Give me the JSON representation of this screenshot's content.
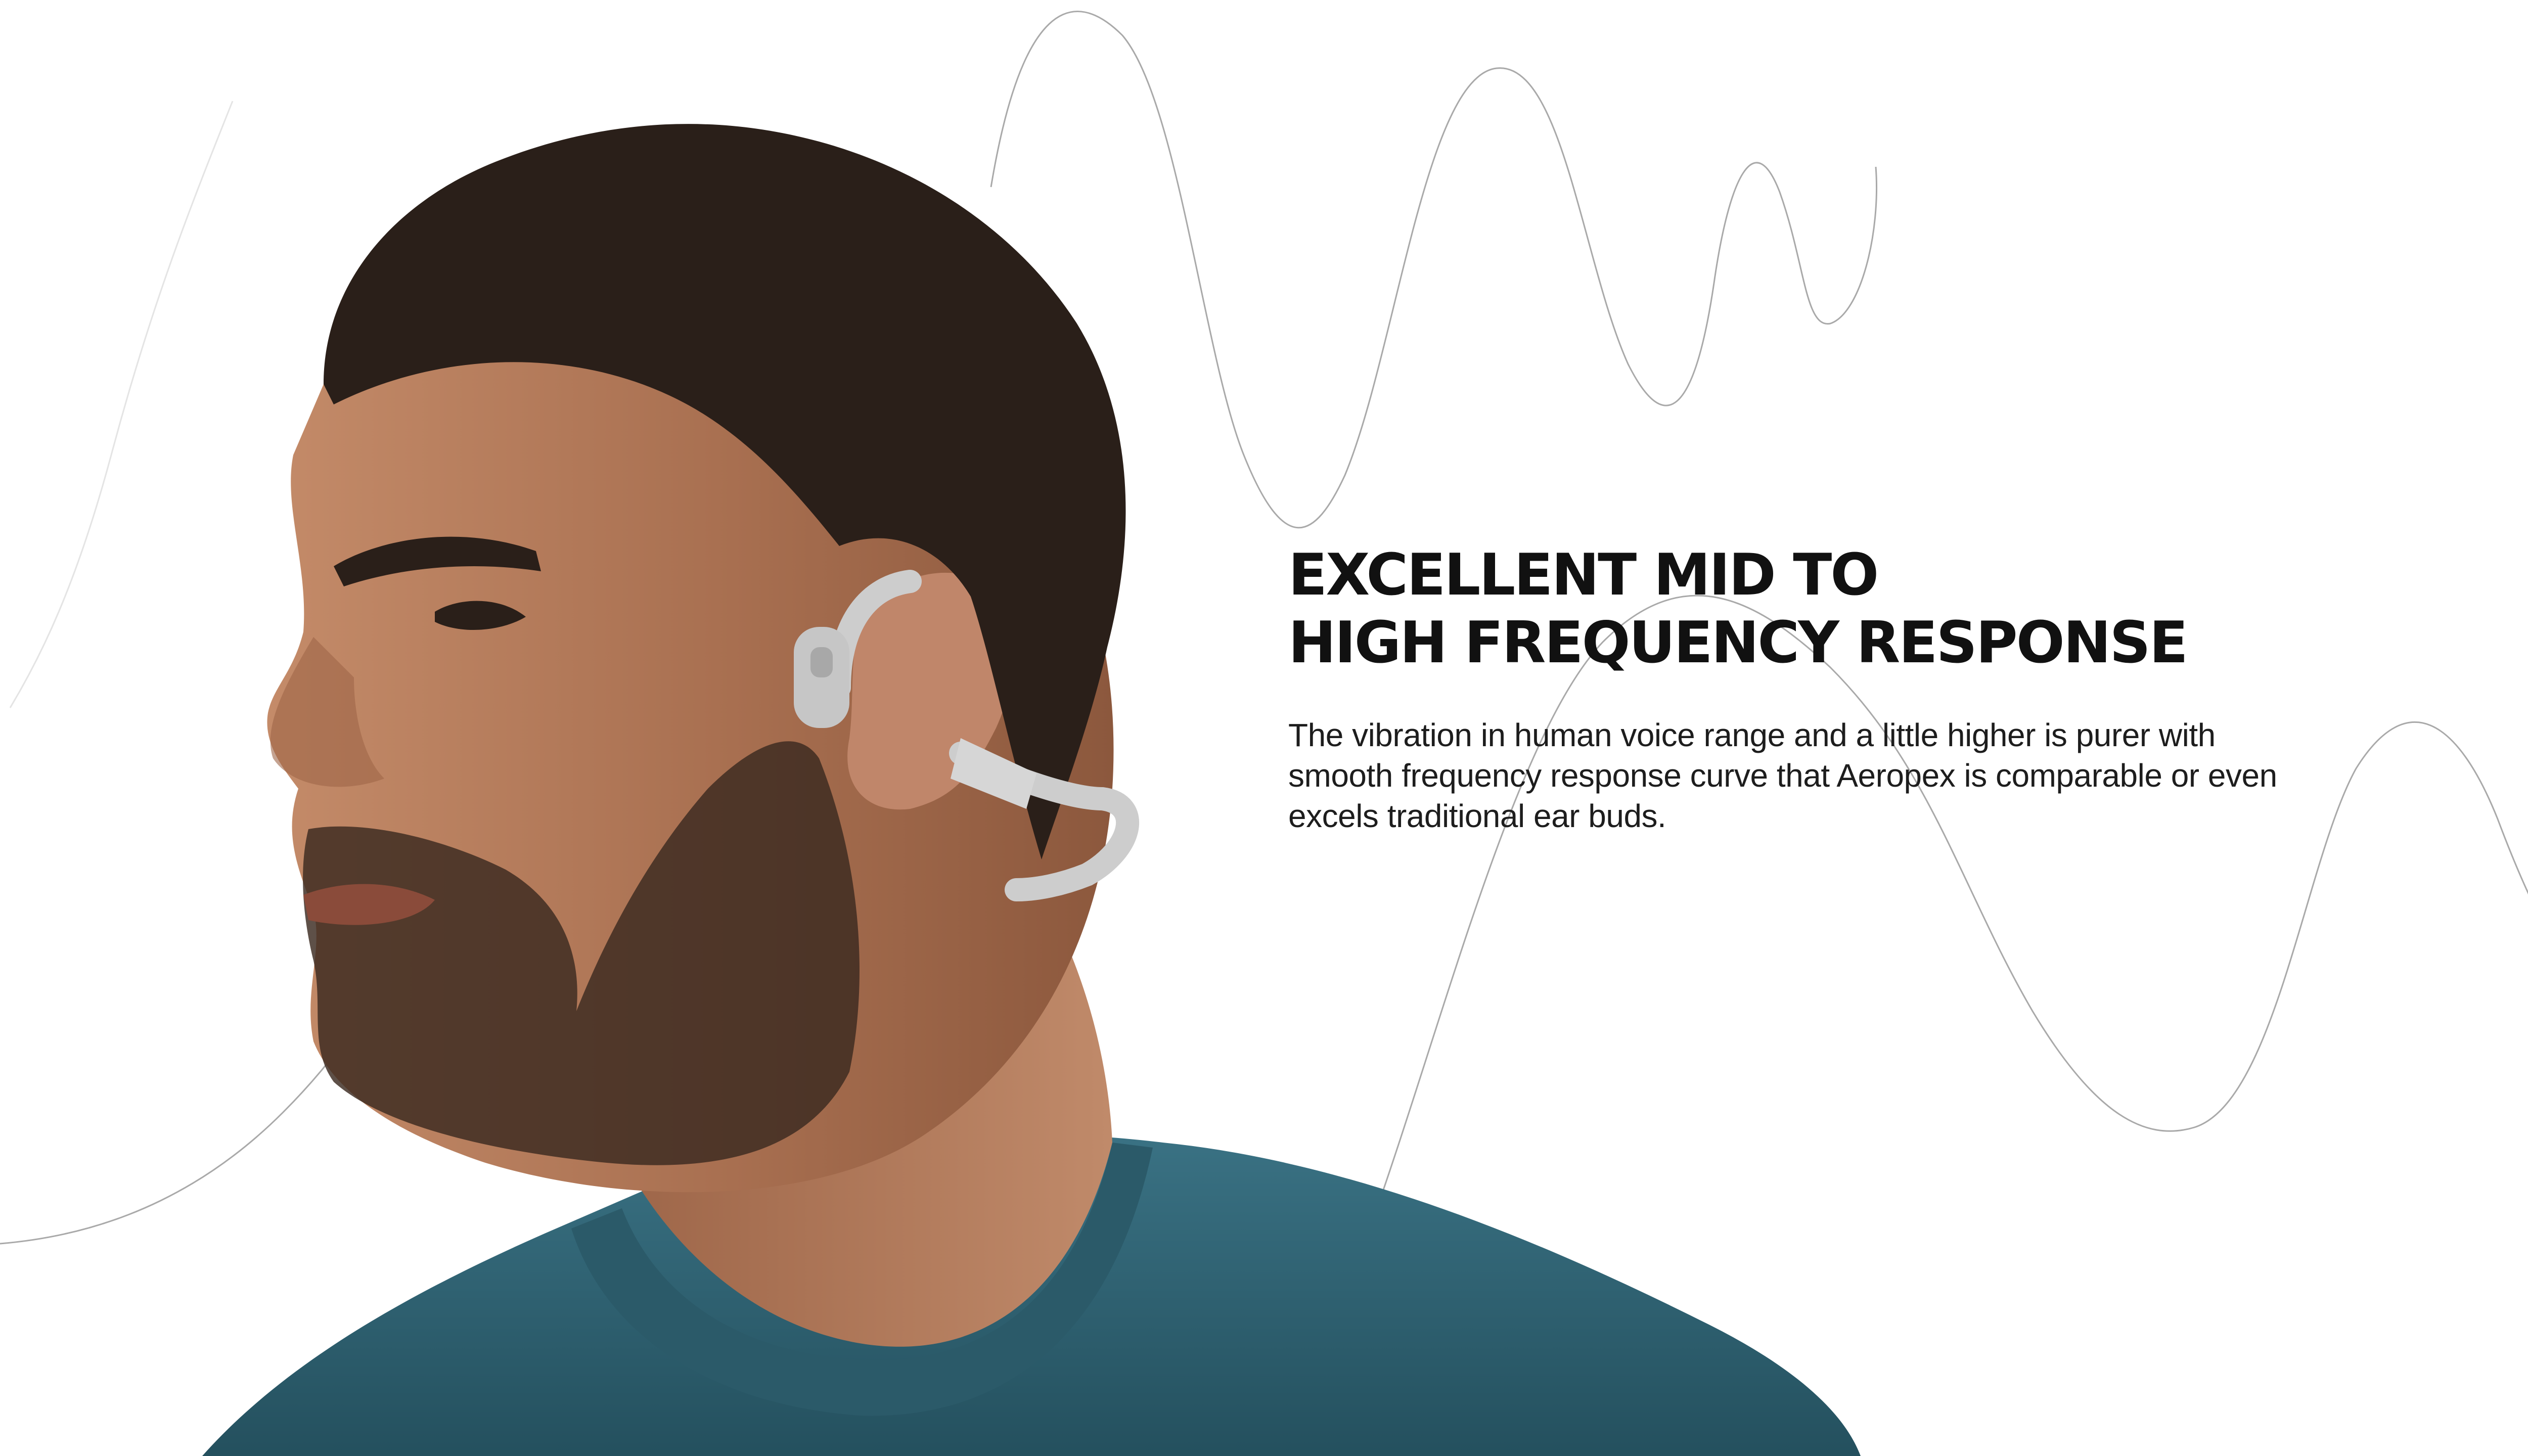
{
  "feature": {
    "headline_line1": "EXCELLENT MID TO",
    "headline_line2": "HIGH FREQUENCY RESPONSE",
    "description": "The vibration in human voice range and a little higher is purer with smooth frequency response curve that Aeropex is comparable or even excels traditional ear buds."
  },
  "colors": {
    "background": "#ffffff",
    "headline": "#111111",
    "body_text": "#1d1d1d",
    "wave_line": "#a9a9a9",
    "shirt": "#2f6272",
    "skin": "#b27a59",
    "hair": "#2a1f19",
    "headphone": "#c9c9c9"
  },
  "graphics": {
    "background_motif": "sound-wave-lines",
    "product": "bone-conduction-headphones",
    "photo_subject": "man-in-teal-t-shirt-wearing-headphones"
  }
}
